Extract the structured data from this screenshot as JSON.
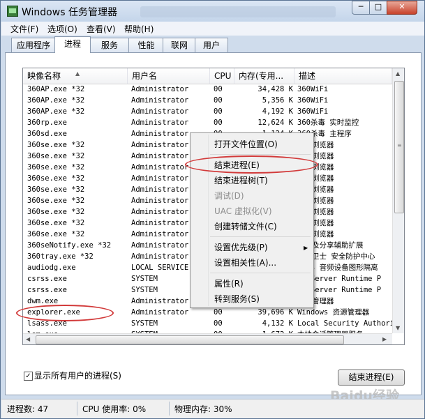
{
  "window": {
    "title": "Windows 任务管理器",
    "minimize": "─",
    "maximize": "□",
    "close": "✕"
  },
  "menu": [
    "文件(F)",
    "选项(O)",
    "查看(V)",
    "帮助(H)"
  ],
  "tabs": [
    "应用程序",
    "进程",
    "服务",
    "性能",
    "联网",
    "用户"
  ],
  "active_tab": "进程",
  "columns": [
    "映像名称",
    "用户名",
    "CPU",
    "内存(专用...",
    "描述"
  ],
  "rows": [
    [
      "360AP.exe *32",
      "Administrator",
      "00",
      "34,428 K",
      "360WiFi"
    ],
    [
      "360AP.exe *32",
      "Administrator",
      "00",
      "5,356 K",
      "360WiFi"
    ],
    [
      "360AP.exe *32",
      "Administrator",
      "00",
      "4,192 K",
      "360WiFi"
    ],
    [
      "360rp.exe",
      "Administrator",
      "00",
      "12,624 K",
      "360杀毒 实时监控"
    ],
    [
      "360sd.exe",
      "Administrator",
      "00",
      "1,124 K",
      "360杀毒 主程序"
    ],
    [
      "360se.exe *32",
      "Administrator",
      "00",
      "",
      "安全浏览器"
    ],
    [
      "360se.exe *32",
      "Administrator",
      "00",
      "",
      "安全浏览器"
    ],
    [
      "360se.exe *32",
      "Administrator",
      "00",
      "",
      "安全浏览器"
    ],
    [
      "360se.exe *32",
      "Administrator",
      "00",
      "",
      "安全浏览器"
    ],
    [
      "360se.exe *32",
      "Administrator",
      "00",
      "",
      "安全浏览器"
    ],
    [
      "360se.exe *32",
      "Administrator",
      "00",
      "",
      "安全浏览器"
    ],
    [
      "360se.exe *32",
      "Administrator",
      "00",
      "",
      "安全浏览器"
    ],
    [
      "360se.exe *32",
      "Administrator",
      "00",
      "",
      "安全浏览器"
    ],
    [
      "360se.exe *32",
      "Administrator",
      "00",
      "",
      "安全浏览器"
    ],
    [
      "360seNotify.exe *32",
      "Administrator",
      "00",
      "",
      "提醒及分享辅助扩展"
    ],
    [
      "360tray.exe *32",
      "Administrator",
      "00",
      "",
      "安全卫士 安全防护中心"
    ],
    [
      "audiodg.exe",
      "LOCAL SERVICE",
      "00",
      "",
      "dows 音频设备图形隔离"
    ],
    [
      "csrss.exe",
      "SYSTEM",
      "00",
      "",
      "nt Server Runtime P"
    ],
    [
      "csrss.exe",
      "SYSTEM",
      "00",
      "",
      "nt Server Runtime P"
    ],
    [
      "dwm.exe",
      "Administrator",
      "00",
      "",
      "窗口管理器"
    ],
    [
      "explorer.exe",
      "Administrator",
      "00",
      "39,696 K",
      "Windows 资源管理器"
    ],
    [
      "lsass.exe",
      "SYSTEM",
      "00",
      "4,132 K",
      "Local Security Authority"
    ],
    [
      "lsm.exe",
      "SYSTEM",
      "00",
      "1,672 K",
      "本地会话管理器服务"
    ],
    [
      "OSPPSVC.EXE",
      "NETWORK SERVICE",
      "00",
      "2,620 K",
      "Microsoft Office Software"
    ]
  ],
  "context_menu": [
    {
      "label": "打开文件位置(O)",
      "disabled": false
    },
    {
      "label": "结束进程(E)",
      "disabled": false
    },
    {
      "label": "结束进程树(T)",
      "disabled": false
    },
    {
      "label": "调试(D)",
      "disabled": true
    },
    {
      "label": "UAC 虚拟化(V)",
      "disabled": true
    },
    {
      "label": "创建转储文件(C)",
      "disabled": false
    },
    {
      "label": "设置优先级(P)",
      "disabled": false
    },
    {
      "label": "设置相关性(A)...",
      "disabled": false
    },
    {
      "label": "属性(R)",
      "disabled": false
    },
    {
      "label": "转到服务(S)",
      "disabled": false
    }
  ],
  "show_all_users_label": "显示所有用户的进程(S)",
  "show_all_users_checked": "✓",
  "end_process_button": "结束进程(E)",
  "status": {
    "processes": "进程数: 47",
    "cpu": "CPU 使用率: 0%",
    "memory": "物理内存: 30%"
  },
  "watermark": "Baidu经验",
  "colors": {
    "highlight_ring": "#d23a3a"
  }
}
